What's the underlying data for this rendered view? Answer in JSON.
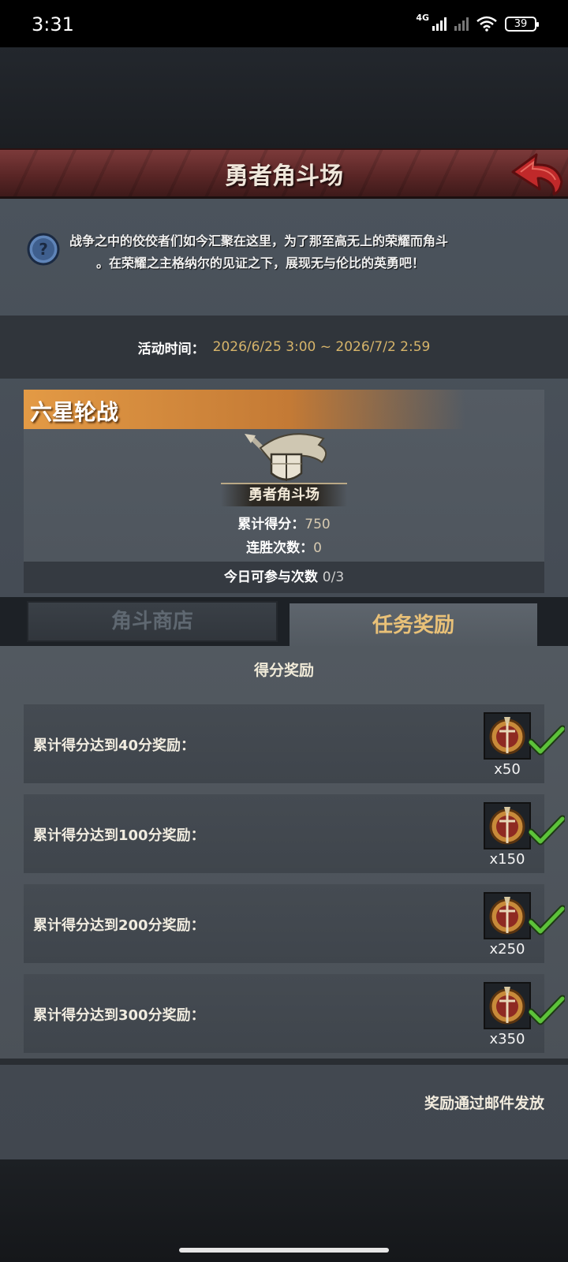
{
  "status_bar": {
    "time": "3:31",
    "network": "4G",
    "battery": "39",
    "icons": [
      "signal-icon",
      "signal-off-icon",
      "wifi-icon",
      "battery-icon"
    ]
  },
  "header": {
    "title": "勇者角斗场",
    "back_icon": "back-arrow-icon"
  },
  "description": {
    "help_icon": "help-icon",
    "line1": "战争之中的佼佼者们如今汇聚在这里，为了那至高无上的荣耀而角斗",
    "line2": "。在荣耀之主格纳尔的见证之下，展现无与伦比的英勇吧！"
  },
  "event_time": {
    "label": "活动时间：",
    "value": "2026/6/25 3:00 ~ 2026/7/2 2:59"
  },
  "mode": {
    "title": "六星轮战",
    "emblem_icon": "shield-banner-emblem-icon",
    "emblem_label": "勇者角斗场",
    "score_label": "累计得分：",
    "score_value": "750",
    "streak_label": "连胜次数：",
    "streak_value": "0",
    "attempts_label": "今日可参与次数",
    "attempts_value": "0/3"
  },
  "tabs": [
    {
      "label": "角斗商店",
      "active": false
    },
    {
      "label": "任务奖励",
      "active": true
    }
  ],
  "rewards": {
    "heading": "得分奖励",
    "items": [
      {
        "label": "累计得分达到40分奖励：",
        "count": "x50",
        "claimed": true
      },
      {
        "label": "累计得分达到100分奖励：",
        "count": "x150",
        "claimed": true
      },
      {
        "label": "累计得分达到200分奖励：",
        "count": "x250",
        "claimed": true
      },
      {
        "label": "累计得分达到300分奖励：",
        "count": "x350",
        "claimed": true
      }
    ],
    "note": "奖励通过邮件发放"
  },
  "colors": {
    "banner": "#5a2626",
    "accent_gold": "#e9c178",
    "time_value": "#d6b46a",
    "mode_header": "#e39a45",
    "check_green": "#5cc23a"
  }
}
